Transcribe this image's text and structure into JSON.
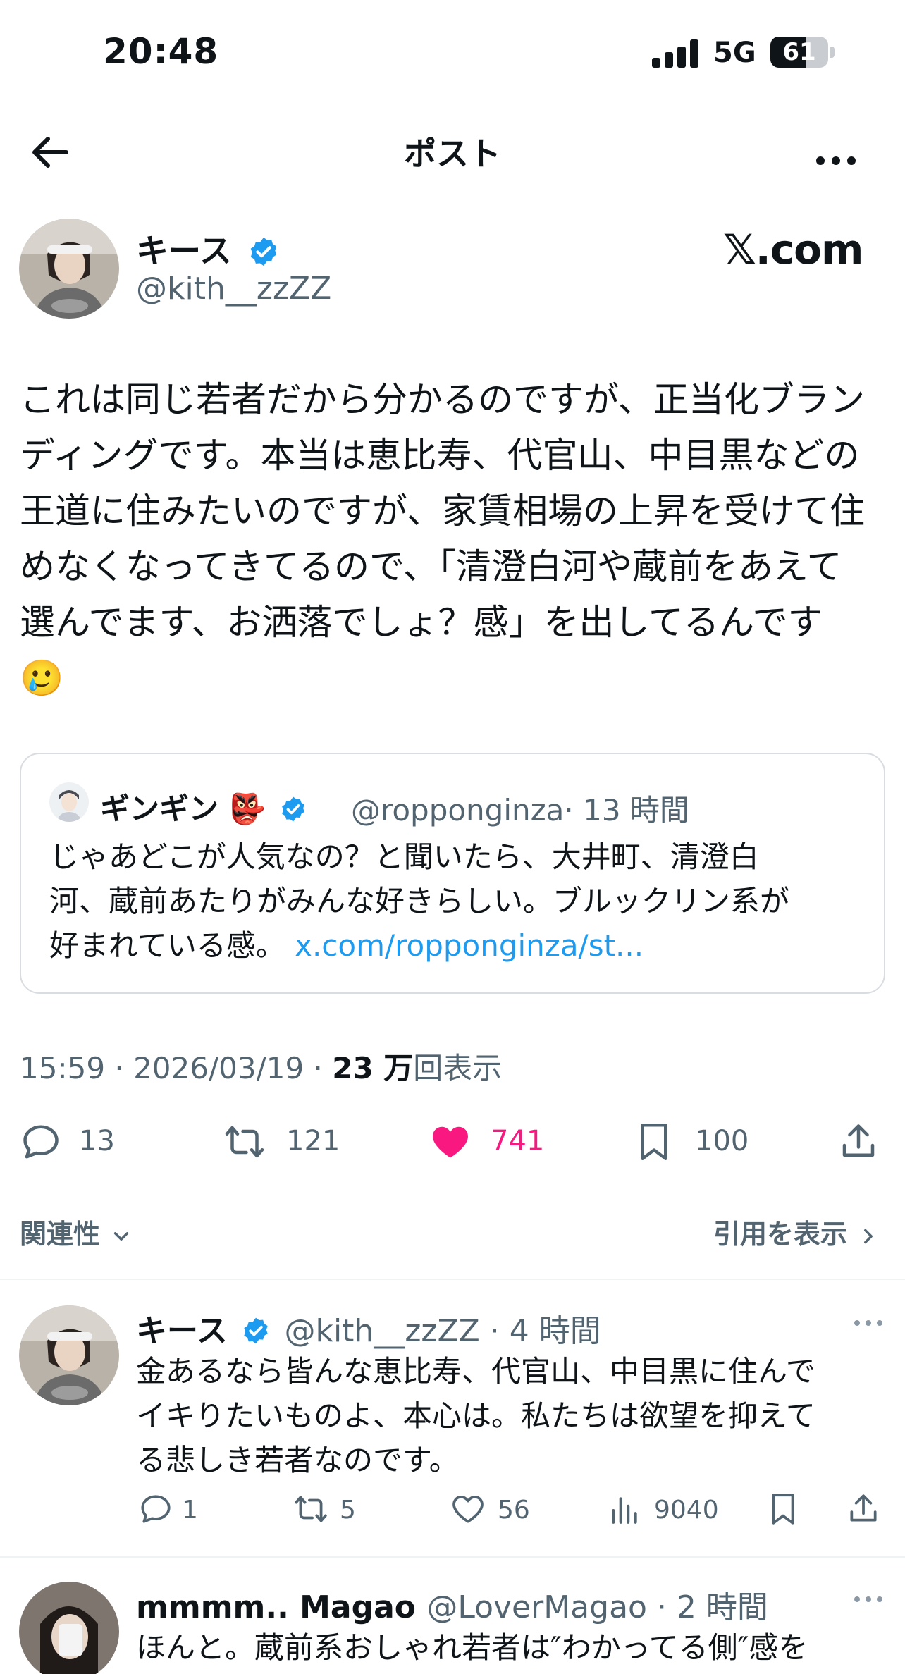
{
  "status": {
    "time": "20:48",
    "network": "5G",
    "battery": "61",
    "battery_level": 0.61
  },
  "nav": {
    "title": "ポスト"
  },
  "post": {
    "author_name": "キース",
    "author_handle": "@kith__zzZZ",
    "source_logo": "𝕏.com",
    "text": "これは同じ若者だから分かるのですが、正当化ブラン\nディングです。本当は恵比寿、代官山、中目黒などの\n王道に住みたいのですが、家賃相場の上昇を受けて住\nめなくなってきてるので、「清澄白河や蔵前をあえて\n選んでます、お洒落でしょ？感」を出してるんです\n🥲",
    "quote": {
      "name": "ギンギン 👺",
      "handle": "@ropponginza",
      "time": "· 13 時間",
      "text": "じゃあどこが人気なの？と聞いたら、大井町、清澄白\n河、蔵前あたりがみんな好きらしい。ブルックリン系が\n好まれている感。 ",
      "link": "x.com/ropponginza/st..."
    },
    "time": "15:59 · 2026/03/19 · ",
    "views": "23 万",
    "views_label": "回表示",
    "stats": {
      "replies": "13",
      "reposts": "121",
      "likes": "741",
      "bookmarks": "100"
    }
  },
  "filters": {
    "sort": "関連性",
    "quotes": "引用を表示"
  },
  "replies": [
    {
      "name": "キース",
      "handle": "@kith__zzZZ · 4 時間",
      "text": "金あるなら皆んな恵比寿、代官山、中目黒に住んで\nイキりたいものよ、本心は。私たちは欲望を抑えて\nる悲しき若者なのです。",
      "replies": "1",
      "reposts": "5",
      "likes": "56",
      "views": "9040"
    },
    {
      "name": "mmmm.. Magao",
      "handle": "@LoverMagao · 2 時間",
      "text": "ほんと。蔵前系おしゃれ若者は″わかってる側″感を"
    }
  ],
  "colors": {
    "accent": "#1d9bf0",
    "like": "#f91880",
    "secondary": "#536471"
  },
  "icons": [
    "back-arrow-icon",
    "more-icon",
    "verified-badge-icon",
    "reply-icon",
    "repost-icon",
    "heart-icon",
    "bookmark-icon",
    "share-icon",
    "views-icon",
    "chevron-down-icon",
    "chevron-right-icon"
  ]
}
